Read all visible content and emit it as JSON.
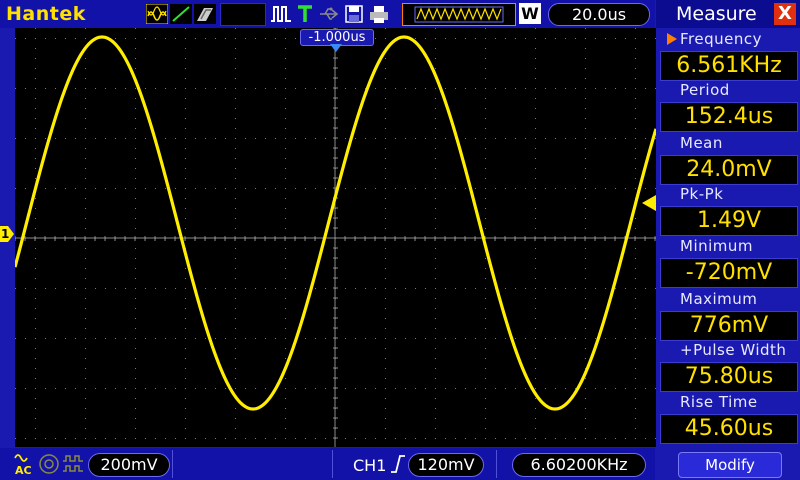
{
  "header": {
    "brand": "Hantek",
    "time_offset": "-1.000us",
    "timebase": "20.0us",
    "acq_mode_label": "W"
  },
  "channel": {
    "marker": "1",
    "volts_div": "200mV"
  },
  "trigger": {
    "source": "CH1",
    "level": "120mV",
    "frequency": "6.60200KHz"
  },
  "measure": {
    "title": "Measure",
    "close_label": "X",
    "items": [
      {
        "label": "Frequency",
        "value": "6.561KHz"
      },
      {
        "label": "Period",
        "value": "152.4us"
      },
      {
        "label": "Mean",
        "value": "24.0mV"
      },
      {
        "label": "Pk-Pk",
        "value": "1.49V"
      },
      {
        "label": "Minimum",
        "value": "-720mV"
      },
      {
        "label": "Maximum",
        "value": "776mV"
      },
      {
        "label": "+Pulse Width",
        "value": "75.80us"
      },
      {
        "label": "Rise Time",
        "value": "45.60us"
      }
    ],
    "modify_label": "Modify"
  },
  "colors": {
    "trace": "#ffee00",
    "background": "#1a1ab0",
    "screen": "#000000",
    "accent": "#ff8000"
  },
  "icons": [
    "wave-mode-icon",
    "line-mode-icon",
    "shade-mode-icon",
    "pulse-icon",
    "trigger-t-icon",
    "usb-icon",
    "save-icon",
    "print-icon",
    "memory-wave-icon",
    "ac-coupling-icon",
    "bw-limit-icon",
    "invert-icon",
    "rising-edge-icon"
  ],
  "waveform": {
    "frequency_khz": 6.561,
    "peak_mV": 776,
    "trough_mV": -720
  }
}
